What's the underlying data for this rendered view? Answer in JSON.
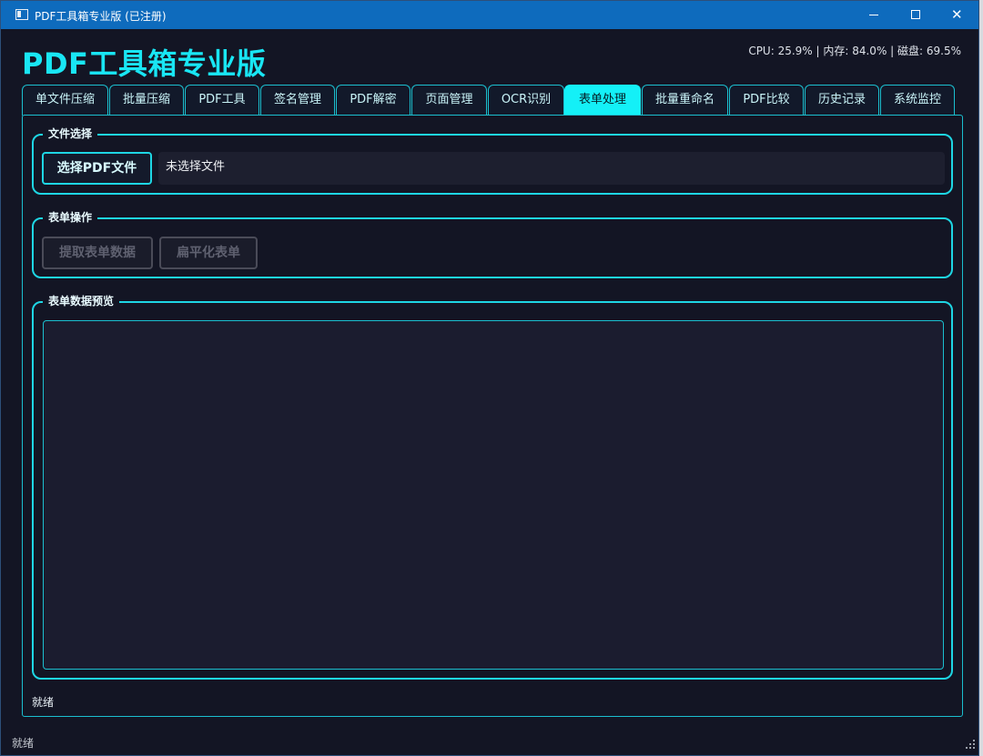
{
  "window": {
    "title": "PDF工具箱专业版 (已注册)",
    "minimize_glyph": "—",
    "maximize_glyph": "☐",
    "close_glyph": "✕"
  },
  "header": {
    "app_title": "PDF工具箱专业版",
    "sys_stats": "CPU: 25.9% | 内存: 84.0% | 磁盘: 69.5%"
  },
  "tabs": [
    {
      "label": "单文件压缩"
    },
    {
      "label": "批量压缩"
    },
    {
      "label": "PDF工具"
    },
    {
      "label": "签名管理"
    },
    {
      "label": "PDF解密"
    },
    {
      "label": "页面管理"
    },
    {
      "label": "OCR识别"
    },
    {
      "label": "表单处理",
      "active": true
    },
    {
      "label": "批量重命名"
    },
    {
      "label": "PDF比较"
    },
    {
      "label": "历史记录"
    },
    {
      "label": "系统监控"
    }
  ],
  "file_group": {
    "title": "文件选择",
    "select_button": "选择PDF文件",
    "file_label": "未选择文件"
  },
  "ops_group": {
    "title": "表单操作",
    "extract_button": "提取表单数据",
    "flatten_button": "扁平化表单"
  },
  "preview_group": {
    "title": "表单数据预览",
    "content": ""
  },
  "inner_status": "就绪",
  "statusbar": "就绪",
  "colors": {
    "accent": "#1ed6e4",
    "active_tab": "#14f0f7",
    "background": "#131524",
    "titlebar": "#0e6bbd"
  }
}
